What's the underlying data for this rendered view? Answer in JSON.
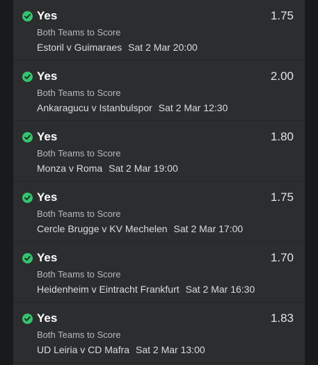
{
  "colors": {
    "background": "#2b2d2f",
    "side_strips": "#181a1b",
    "check_green": "#35c46e",
    "text_primary": "#ffffff",
    "text_secondary": "#b7babd"
  },
  "bets": [
    {
      "icon": "check-circle-icon",
      "selection": "Yes",
      "odds": "1.75",
      "market": "Both Teams to Score",
      "event": "Estoril v Guimaraes",
      "kickoff": "Sat 2 Mar 20:00"
    },
    {
      "icon": "check-circle-icon",
      "selection": "Yes",
      "odds": "2.00",
      "market": "Both Teams to Score",
      "event": "Ankaragucu v Istanbulspor",
      "kickoff": "Sat 2 Mar 12:30"
    },
    {
      "icon": "check-circle-icon",
      "selection": "Yes",
      "odds": "1.80",
      "market": "Both Teams to Score",
      "event": "Monza v Roma",
      "kickoff": "Sat 2 Mar 19:00"
    },
    {
      "icon": "check-circle-icon",
      "selection": "Yes",
      "odds": "1.75",
      "market": "Both Teams to Score",
      "event": "Cercle Brugge v KV Mechelen",
      "kickoff": "Sat 2 Mar 17:00"
    },
    {
      "icon": "check-circle-icon",
      "selection": "Yes",
      "odds": "1.70",
      "market": "Both Teams to Score",
      "event": "Heidenheim v Eintracht Frankfurt",
      "kickoff": "Sat 2 Mar 16:30"
    },
    {
      "icon": "check-circle-icon",
      "selection": "Yes",
      "odds": "1.83",
      "market": "Both Teams to Score",
      "event": "UD Leiria v CD Mafra",
      "kickoff": "Sat 2 Mar 13:00"
    }
  ]
}
